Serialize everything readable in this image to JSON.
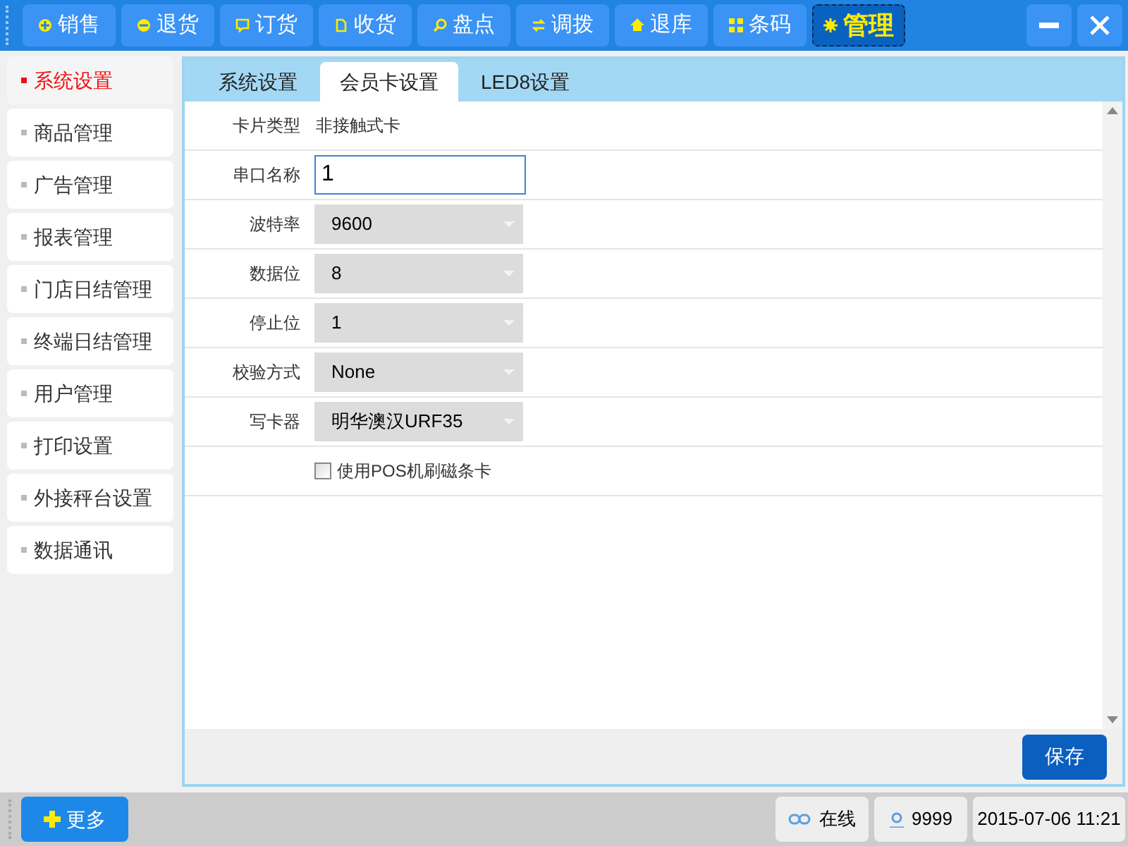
{
  "toolbar": [
    {
      "label": "销售",
      "selected": false
    },
    {
      "label": "退货",
      "selected": false
    },
    {
      "label": "订货",
      "selected": false
    },
    {
      "label": "收货",
      "selected": false
    },
    {
      "label": "盘点",
      "selected": false
    },
    {
      "label": "调拨",
      "selected": false
    },
    {
      "label": "退库",
      "selected": false
    },
    {
      "label": "条码",
      "selected": false
    },
    {
      "label": "管理",
      "selected": true
    }
  ],
  "sidebar": {
    "items": [
      {
        "label": "系统设置",
        "selected": true
      },
      {
        "label": "商品管理",
        "selected": false
      },
      {
        "label": "广告管理",
        "selected": false
      },
      {
        "label": "报表管理",
        "selected": false
      },
      {
        "label": "门店日结管理",
        "selected": false
      },
      {
        "label": "终端日结管理",
        "selected": false
      },
      {
        "label": "用户管理",
        "selected": false
      },
      {
        "label": "打印设置",
        "selected": false
      },
      {
        "label": "外接秤台设置",
        "selected": false
      },
      {
        "label": "数据通讯",
        "selected": false
      }
    ]
  },
  "tabs": [
    {
      "label": "系统设置",
      "selected": false
    },
    {
      "label": "会员卡设置",
      "selected": true
    },
    {
      "label": "LED8设置",
      "selected": false
    }
  ],
  "form": [
    {
      "kind": "text",
      "label": "卡片类型",
      "value": "非接触式卡"
    },
    {
      "kind": "input",
      "label": "串口名称",
      "value": "1"
    },
    {
      "kind": "select",
      "label": "波特率",
      "value": "9600"
    },
    {
      "kind": "select",
      "label": "数据位",
      "value": "8"
    },
    {
      "kind": "select",
      "label": "停止位",
      "value": "1"
    },
    {
      "kind": "select",
      "label": "校验方式",
      "value": "None"
    },
    {
      "kind": "select",
      "label": "写卡器",
      "value": "明华澳汉URF35"
    },
    {
      "kind": "checkbox",
      "label": "使用POS机刷磁条卡",
      "checked": false
    }
  ],
  "save_button": "保存",
  "status_bar": {
    "more_button": "更多",
    "connection": "在线",
    "user": "9999",
    "datetime": "2015-07-06 11:21"
  }
}
